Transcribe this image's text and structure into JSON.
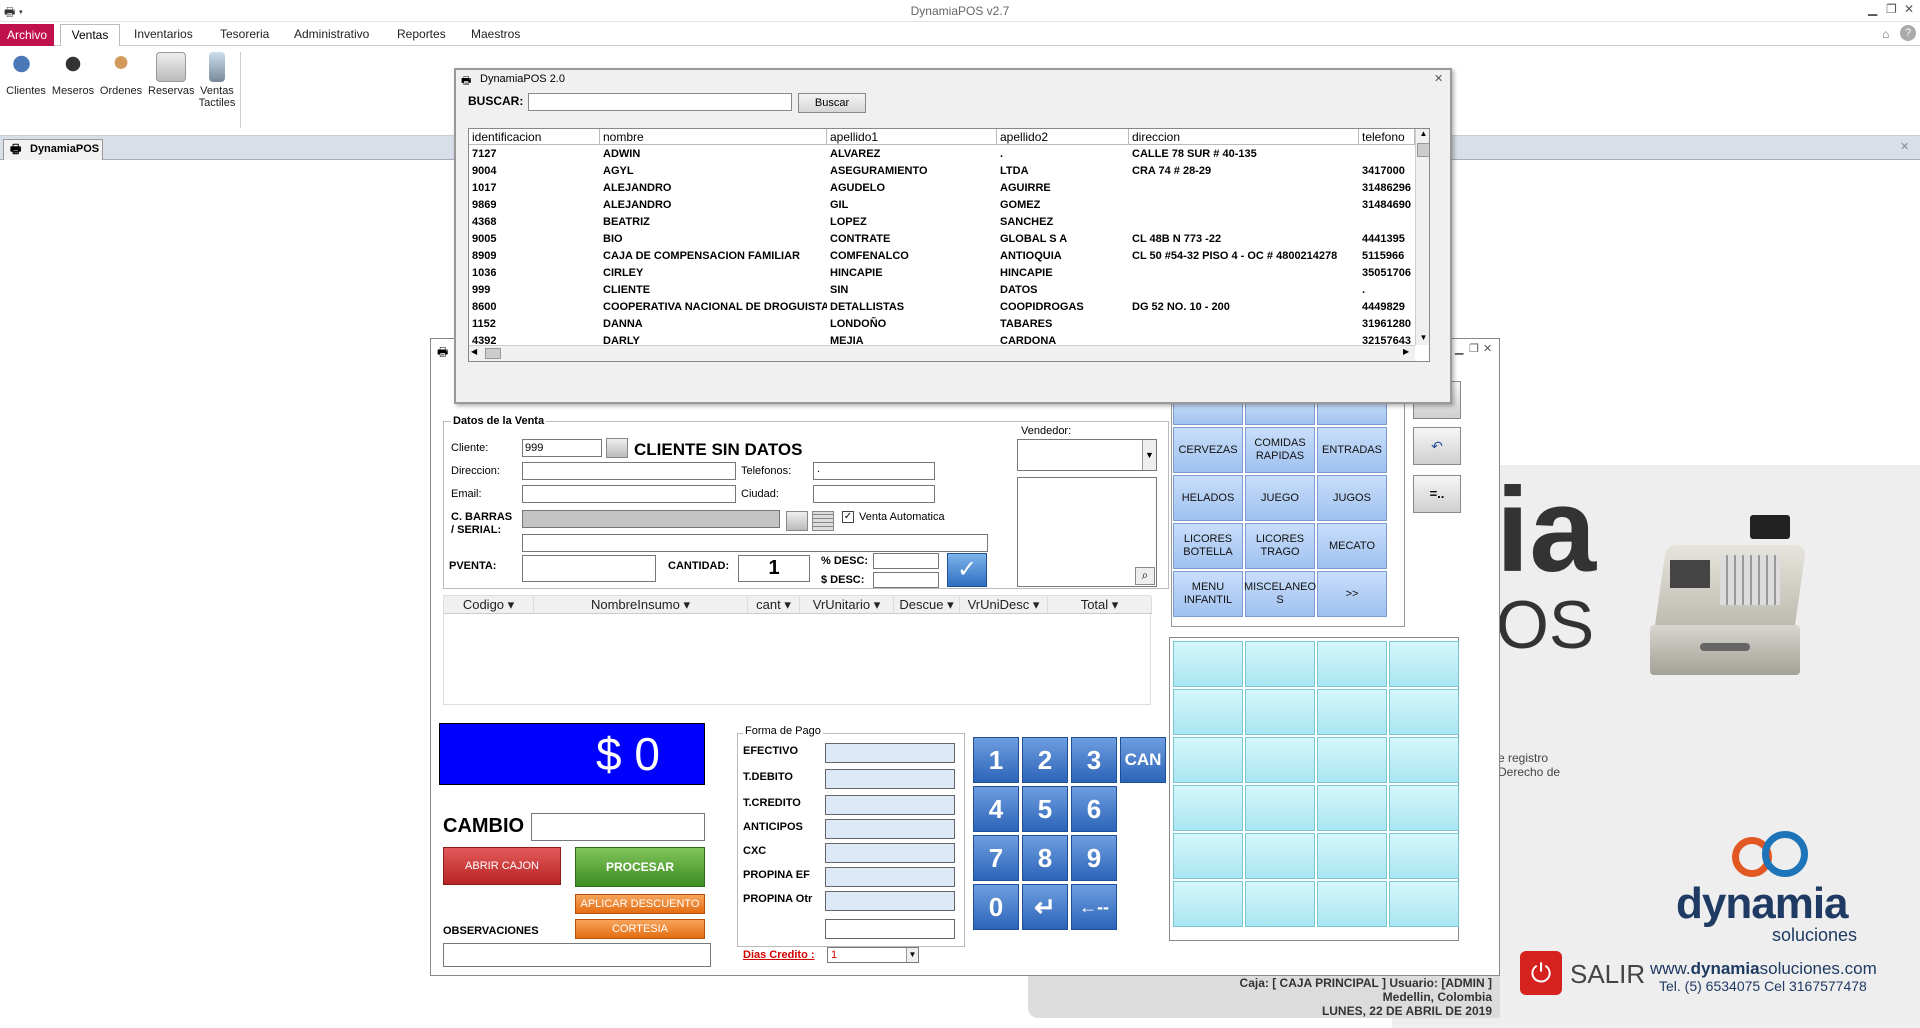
{
  "app": {
    "title": "DynamiaPOS v2.7"
  },
  "menu": {
    "archivo": "Archivo",
    "ventas": "Ventas",
    "inventarios": "Inventarios",
    "tesoreria": "Tesoreria",
    "administrativo": "Administrativo",
    "reportes": "Reportes",
    "maestros": "Maestros"
  },
  "ribbon": {
    "clientes": "Clientes",
    "meseros": "Meseros",
    "ordenes": "Ordenes",
    "reservas": "Reservas",
    "ventas_tactiles_1": "Ventas",
    "ventas_tactiles_2": "Tactiles"
  },
  "doc_tab": "DynamiaPOS",
  "search_dialog": {
    "title": "DynamiaPOS 2.0",
    "buscar_label": "BUSCAR:",
    "buscar_value": "",
    "buscar_button": "Buscar",
    "columns": [
      "identificacion",
      "nombre",
      "apellido1",
      "apellido2",
      "direccion",
      "telefono"
    ],
    "rows": [
      [
        "7127",
        "ADWIN",
        "ALVAREZ",
        ".",
        "CALLE 78 SUR # 40-135",
        ""
      ],
      [
        "9004",
        "AGYL",
        "ASEGURAMIENTO",
        "LTDA",
        "CRA 74 # 28-29",
        "3417000"
      ],
      [
        "1017",
        "ALEJANDRO",
        "AGUDELO",
        "AGUIRRE",
        "",
        "31486296"
      ],
      [
        "9869",
        "ALEJANDRO",
        "GIL",
        "GOMEZ",
        "",
        "31484690"
      ],
      [
        "4368",
        "BEATRIZ",
        "LOPEZ",
        "SANCHEZ",
        "",
        ""
      ],
      [
        "9005",
        "BIO",
        "CONTRATE",
        "GLOBAL S A",
        "CL 48B N 773 -22",
        "4441395"
      ],
      [
        "8909",
        "CAJA DE COMPENSACION FAMILIAR",
        "COMFENALCO",
        "ANTIOQUIA",
        "CL 50 #54-32 PISO 4 - OC # 4800214278",
        "5115966"
      ],
      [
        "1036",
        "CIRLEY",
        "HINCAPIE",
        "HINCAPIE",
        "",
        "35051706"
      ],
      [
        "999",
        "CLIENTE",
        "SIN",
        "DATOS",
        "",
        "."
      ],
      [
        "8600",
        "COOPERATIVA NACIONAL DE DROGUISTA",
        "DETALLISTAS",
        "COOPIDROGAS",
        "DG 52 NO. 10 - 200",
        "4449829"
      ],
      [
        "1152",
        "DANNA",
        "LONDOÑO",
        "TABARES",
        "",
        "31961280"
      ],
      [
        "4392",
        "DARLY",
        "MEJIA",
        "CARDONA",
        "",
        "32157643"
      ]
    ]
  },
  "sale": {
    "section_title": "Datos de la Venta",
    "cliente_label": "Cliente:",
    "cliente_value": "999",
    "cliente_name": "CLIENTE SIN DATOS",
    "direccion_label": "Direccion:",
    "telefonos_label": "Telefonos:",
    "telefonos_value": ".",
    "email_label": "Email:",
    "ciudad_label": "Ciudad:",
    "cbarras_label_1": "C. BARRAS",
    "cbarras_label_2": "/ SERIAL:",
    "venta_automatica": "Venta Automatica",
    "pventa_label": "PVENTA:",
    "cantidad_label": "CANTIDAD:",
    "cantidad_value": "1",
    "pdesc_label": "% DESC:",
    "sdesc_label": "$ DESC:",
    "vendedor_label": "Vendedor:"
  },
  "items_table": {
    "columns": [
      "Codigo",
      "NombreInsumo",
      "cant",
      "VrUnitario",
      "Descue",
      "VrUniDesc",
      "Total"
    ]
  },
  "categories": [
    "CERVEZAS",
    "COMIDAS RAPIDAS",
    "ENTRADAS",
    "HELADOS",
    "JUEGO",
    "JUGOS",
    "LICORES BOTELLA",
    "LICORES TRAGO",
    "MECATO",
    "MENU INFANTIL",
    "MISCELANEO S",
    ">>"
  ],
  "total_display": "$ 0",
  "cambio_label": "CAMBIO",
  "buttons": {
    "abrir_cajon": "ABRIR CAJON",
    "procesar": "PROCESAR",
    "aplicar_descuento": "APLICAR DESCUENTO %",
    "cortesia": "CORTESIA"
  },
  "observaciones_label": "OBSERVACIONES",
  "payment": {
    "title": "Forma de Pago",
    "methods": [
      "EFECTIVO",
      "T.DEBITO",
      "T.CREDITO",
      "ANTICIPOS",
      "CXC",
      "PROPINA EF",
      "PROPINA Otr"
    ],
    "dias_credito_label": "Dias Credito :",
    "dias_credito_value": "1"
  },
  "keypad": [
    "1",
    "2",
    "3",
    "CAN",
    "4",
    "5",
    "6",
    "7",
    "8",
    "9",
    "0",
    "↵",
    "←--"
  ],
  "status": {
    "caja": "Caja: [ CAJA PRINCIPAL ] Usuario: [ADMIN ]",
    "ciudad": "Medellin, Colombia",
    "fecha": "LUNES, 22 DE ABRIL DE 2019"
  },
  "brand": {
    "big_a": "ia",
    "big_b": "OS",
    "registro_1": "e registro",
    "registro_2": "Derecho de",
    "logo": "dynamia",
    "logo_sub": "soluciones",
    "website_a": "www.",
    "website_b": "dynamia",
    "website_c": "soluciones.com",
    "tel": "Tel. (5) 6534075 Cel 3167577478",
    "salir": "SALIR"
  },
  "colors": {
    "accent": "#c0114d",
    "total_bg": "#0000ff",
    "numkey": "#2c64b8",
    "abrir": "#d23b3b",
    "procesar": "#5ba23a",
    "descuento": "#f07a1e"
  }
}
